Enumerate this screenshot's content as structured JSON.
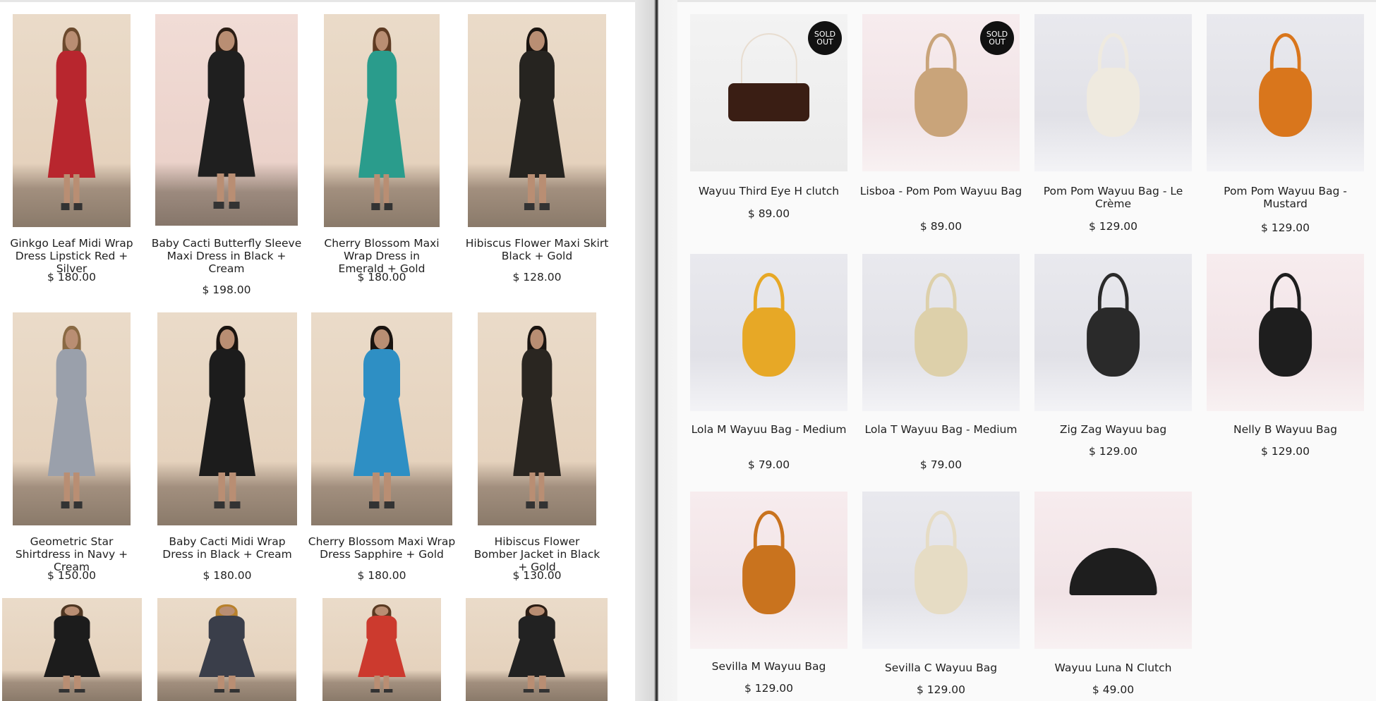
{
  "left_catalog": {
    "products": [
      {
        "name": "Ginkgo Leaf Midi Wrap Dress Lipstick Red + Silver",
        "price": "$ 180.00",
        "backdrop": "beige",
        "garment": "#b8262e",
        "hair": "#6b4a2e"
      },
      {
        "name": "Baby Cacti Butterfly Sleeve Maxi Dress in Black + Cream",
        "price": "$ 198.00",
        "backdrop": "pink",
        "garment": "#1f1f1f",
        "hair": "#2b1d14"
      },
      {
        "name": "Cherry Blossom Maxi Wrap Dress in Emerald + Gold",
        "price": "$ 180.00",
        "backdrop": "beige",
        "garment": "#2a9c8c",
        "hair": "#5e3b23"
      },
      {
        "name": "Hibiscus Flower Maxi Skirt Black + Gold",
        "price": "$ 128.00",
        "backdrop": "beige",
        "garment": "#262420",
        "hair": "#1a1410"
      },
      {
        "name": "Geometric Star Shirtdress in Navy + Cream",
        "price": "$ 150.00",
        "backdrop": "beige",
        "garment": "#9aa0ab",
        "hair": "#8a6a44"
      },
      {
        "name": "Baby Cacti Midi Wrap Dress in Black + Cream",
        "price": "$ 180.00",
        "backdrop": "beige",
        "garment": "#1c1c1c",
        "hair": "#1a1410"
      },
      {
        "name": "Cherry Blossom Maxi Wrap Dress Sapphire + Gold",
        "price": "$ 180.00",
        "backdrop": "beige",
        "garment": "#2e8fc4",
        "hair": "#1a1410"
      },
      {
        "name": "Hibiscus Flower Bomber Jacket in Black + Gold",
        "price": "$ 130.00",
        "backdrop": "beige",
        "garment": "#2a2621",
        "hair": "#1a1410"
      },
      {
        "name": "",
        "price": "",
        "backdrop": "beige",
        "garment": "#1c1c1c",
        "hair": "#4e3622"
      },
      {
        "name": "",
        "price": "",
        "backdrop": "beige",
        "garment": "#3a3e4a",
        "hair": "#b8812c"
      },
      {
        "name": "",
        "price": "",
        "backdrop": "beige",
        "garment": "#cc3a2e",
        "hair": "#5a3a22"
      },
      {
        "name": "",
        "price": "",
        "backdrop": "beige",
        "garment": "#222222",
        "hair": "#2b1d14"
      }
    ]
  },
  "right_catalog": {
    "sold_out_label": [
      "SOLD",
      "OUT"
    ],
    "products": [
      {
        "name": "Wayuu Third Eye H clutch",
        "price": "$ 89.00",
        "sold_out": true,
        "backdrop": "white",
        "shape": "clutch",
        "color": "#3a1e14"
      },
      {
        "name": "Lisboa - Pom Pom Wayuu Bag",
        "price": "$ 89.00",
        "sold_out": true,
        "backdrop": "blush",
        "shape": "bucket",
        "color": "#c9a47a"
      },
      {
        "name": "Pom Pom Wayuu Bag - Le Crème",
        "price": "$ 129.00",
        "sold_out": false,
        "backdrop": "grey",
        "shape": "bucket",
        "color": "#efeadf"
      },
      {
        "name": "Pom Pom Wayuu Bag - Mustard",
        "price": "$ 129.00",
        "sold_out": false,
        "backdrop": "grey",
        "shape": "bucket",
        "color": "#d9761c"
      },
      {
        "name": "Lola M Wayuu Bag - Medium",
        "price": "$ 79.00",
        "sold_out": false,
        "backdrop": "grey",
        "shape": "bucket",
        "color": "#e7a826"
      },
      {
        "name": "Lola T Wayuu Bag - Medium",
        "price": "$ 79.00",
        "sold_out": false,
        "backdrop": "grey",
        "shape": "bucket",
        "color": "#ddd0aa"
      },
      {
        "name": "Zig Zag Wayuu bag",
        "price": "$ 129.00",
        "sold_out": false,
        "backdrop": "grey",
        "shape": "bucket",
        "color": "#2a2a2a"
      },
      {
        "name": "Nelly B Wayuu Bag",
        "price": "$ 129.00",
        "sold_out": false,
        "backdrop": "blush",
        "shape": "bucket",
        "color": "#1e1e1e"
      },
      {
        "name": "Sevilla M Wayuu Bag",
        "price": "$ 129.00",
        "sold_out": false,
        "backdrop": "blush",
        "shape": "bucket",
        "color": "#c9731e"
      },
      {
        "name": "Sevilla C Wayuu Bag",
        "price": "$ 129.00",
        "sold_out": false,
        "backdrop": "grey",
        "shape": "bucket",
        "color": "#e6dcc4"
      },
      {
        "name": "Wayuu Luna N Clutch",
        "price": "$ 49.00",
        "sold_out": false,
        "backdrop": "blush",
        "shape": "half",
        "color": "#1e1e1e"
      }
    ]
  }
}
